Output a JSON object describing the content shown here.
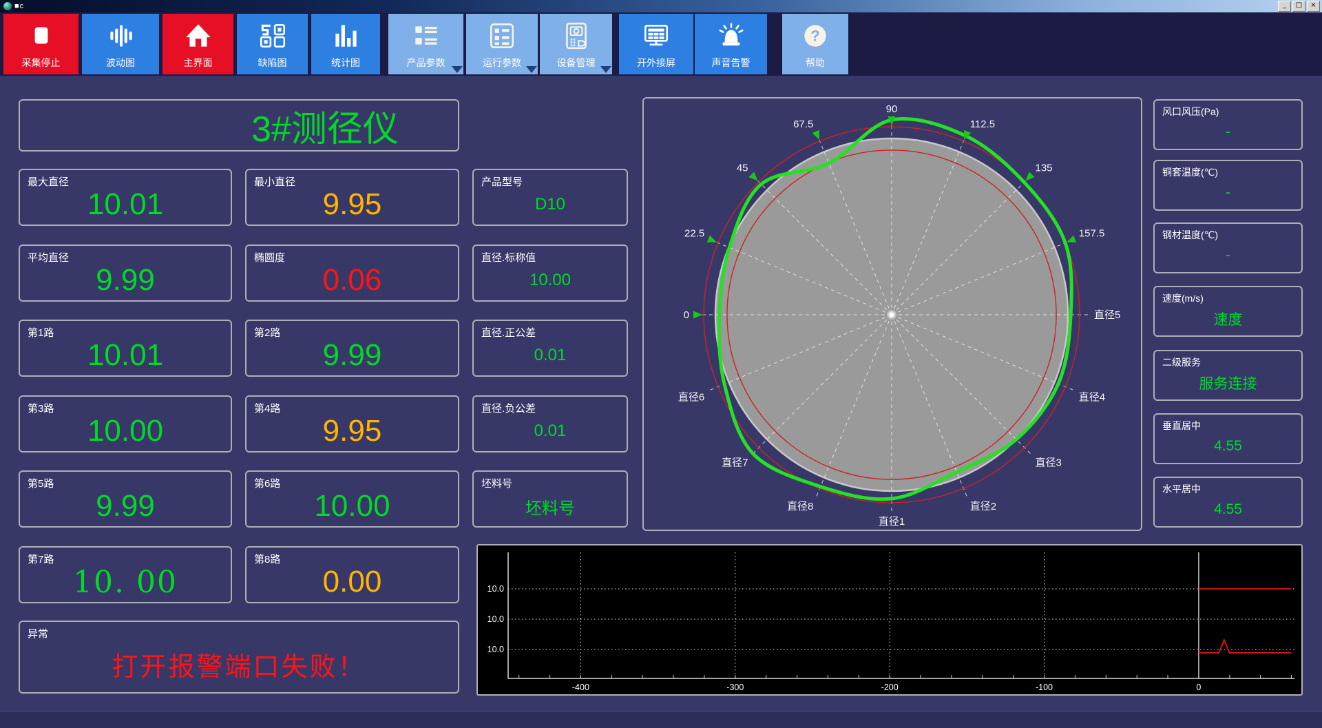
{
  "window": {
    "title": "■c",
    "controls": {
      "minimize": "_",
      "restore": "□",
      "close": "×"
    }
  },
  "toolbar": {
    "buttons": [
      {
        "name": "stop-capture",
        "label": "采集停止",
        "icon": "stop-icon",
        "style": "red",
        "dropdown": false
      },
      {
        "name": "wave-chart",
        "label": "波动图",
        "icon": "waveform-icon",
        "style": "blue",
        "dropdown": false
      },
      {
        "name": "main-screen",
        "label": "主界面",
        "icon": "home-icon",
        "style": "red",
        "dropdown": false
      },
      {
        "name": "defect-chart",
        "label": "缺陷图",
        "icon": "defect-grid-icon",
        "style": "blue",
        "dropdown": false
      },
      {
        "name": "stats-chart",
        "label": "统计图",
        "icon": "bar-chart-icon",
        "style": "blue",
        "dropdown": false
      },
      {
        "name": "product-params",
        "label": "产品参数",
        "icon": "list-icon",
        "style": "light",
        "dropdown": true
      },
      {
        "name": "run-params",
        "label": "运行参数",
        "icon": "form-icon",
        "style": "light",
        "dropdown": true
      },
      {
        "name": "device-manage",
        "label": "设备管理",
        "icon": "device-icon",
        "style": "light",
        "dropdown": true
      },
      {
        "name": "external-screen",
        "label": "开外接屏",
        "icon": "monitor-icon",
        "style": "blue",
        "dropdown": false
      },
      {
        "name": "sound-alarm",
        "label": "声音告警",
        "icon": "siren-icon",
        "style": "blue",
        "dropdown": false
      },
      {
        "name": "help",
        "label": "帮助",
        "icon": "help-icon",
        "style": "light",
        "dropdown": false
      }
    ]
  },
  "gauge_title": "3#测径仪",
  "metrics": {
    "col1": [
      {
        "name": "max-diameter",
        "label": "最大直径",
        "value": "10.01",
        "color": "green",
        "size": "big"
      },
      {
        "name": "avg-diameter",
        "label": "平均直径",
        "value": "9.99",
        "color": "green",
        "size": "big"
      },
      {
        "name": "path-1",
        "label": "第1路",
        "value": "10.01",
        "color": "green",
        "size": "big"
      },
      {
        "name": "path-3",
        "label": "第3路",
        "value": "10.00",
        "color": "green",
        "size": "big"
      },
      {
        "name": "path-5",
        "label": "第5路",
        "value": "9.99",
        "color": "green",
        "size": "big"
      },
      {
        "name": "path-7",
        "label": "第7路",
        "value": "10. 00",
        "color": "green",
        "size": "big",
        "serif": true
      }
    ],
    "col2": [
      {
        "name": "min-diameter",
        "label": "最小直径",
        "value": "9.95",
        "color": "orange",
        "size": "big"
      },
      {
        "name": "ovality",
        "label": "椭圆度",
        "value": "0.06",
        "color": "red",
        "size": "big"
      },
      {
        "name": "path-2",
        "label": "第2路",
        "value": "9.99",
        "color": "green",
        "size": "big"
      },
      {
        "name": "path-4",
        "label": "第4路",
        "value": "9.95",
        "color": "orange",
        "size": "big"
      },
      {
        "name": "path-6",
        "label": "第6路",
        "value": "10.00",
        "color": "green",
        "size": "big"
      },
      {
        "name": "path-8",
        "label": "第8路",
        "value": "0.00",
        "color": "orange",
        "size": "big"
      }
    ],
    "col3": [
      {
        "name": "product-model",
        "label": "产品型号",
        "value": "D10",
        "color": "green",
        "size": "small"
      },
      {
        "name": "nominal-diameter",
        "label": "直径.标称值",
        "value": "10.00",
        "color": "green",
        "size": "small"
      },
      {
        "name": "plus-tolerance",
        "label": "直径.正公差",
        "value": "0.01",
        "color": "green",
        "size": "small"
      },
      {
        "name": "minus-tolerance",
        "label": "直径.负公差",
        "value": "0.01",
        "color": "green",
        "size": "small"
      },
      {
        "name": "billet-no",
        "label": "坯料号",
        "value": "坯料号",
        "color": "green",
        "size": "small"
      }
    ]
  },
  "alarm": {
    "label": "异常",
    "value": "打开报警端口失败！"
  },
  "right_panel": [
    {
      "name": "air-pressure",
      "label": "风口风压(Pa)",
      "value": "-"
    },
    {
      "name": "copper-sleeve-temp",
      "label": "铜套温度(℃)",
      "value": "-"
    },
    {
      "name": "steel-temp",
      "label": "钢材温度(℃)",
      "value": "-"
    },
    {
      "name": "speed",
      "label": "速度(m/s)",
      "value": "速度"
    },
    {
      "name": "l2-service",
      "label": "二级服务",
      "value": "服务连接"
    },
    {
      "name": "vertical-center",
      "label": "垂直居中",
      "value": "4.55"
    },
    {
      "name": "horizontal-center",
      "label": "水平居中",
      "value": "4.55"
    }
  ],
  "colors": {
    "green": "#00d926",
    "orange": "#ffb400",
    "red": "#ff1414",
    "label": "#ffffff"
  },
  "chart_data": [
    {
      "type": "polar_profile",
      "title": "cross-section diameter profile (green = measured, red rings = tolerance, gray disc = nominal)",
      "nominal_radius_rel": 1.0,
      "tolerance_rings_rel": [
        0.934,
        1.066
      ],
      "spoke_step_deg": 22.5,
      "labels": [
        {
          "text": "0",
          "deg": 180,
          "marker": true
        },
        {
          "text": "22.5",
          "deg": 157.5,
          "marker": true
        },
        {
          "text": "45",
          "deg": 135,
          "marker": true
        },
        {
          "text": "67.5",
          "deg": 112.5,
          "marker": true
        },
        {
          "text": "90",
          "deg": 90,
          "marker": true
        },
        {
          "text": "112.5",
          "deg": 67.5,
          "marker": true
        },
        {
          "text": "135",
          "deg": 45,
          "marker": true
        },
        {
          "text": "157.5",
          "deg": 22.5,
          "marker": true
        },
        {
          "text": "直径5",
          "deg": 0,
          "marker": false
        },
        {
          "text": "直径4",
          "deg": -22.5,
          "marker": false
        },
        {
          "text": "直径3",
          "deg": -45,
          "marker": false
        },
        {
          "text": "直径2",
          "deg": -67.5,
          "marker": false
        },
        {
          "text": "直径1",
          "deg": -90,
          "marker": false
        },
        {
          "text": "直径8",
          "deg": -112.5,
          "marker": false
        },
        {
          "text": "直径7",
          "deg": -135,
          "marker": false
        },
        {
          "text": "直径6",
          "deg": -157.5,
          "marker": false
        }
      ],
      "profile": {
        "angles_deg": [
          180,
          157.5,
          135,
          112.5,
          90,
          67.5,
          45,
          22.5,
          0,
          -22.5,
          -45,
          -67.5,
          -90,
          -112.5,
          -135,
          -157.5
        ],
        "r_rel": [
          0.977,
          0.996,
          1.047,
          0.93,
          1.105,
          1.098,
          1.063,
          1.066,
          1.016,
          1.023,
          1.0,
          0.965,
          1.043,
          1.055,
          1.113,
          1.027
        ]
      },
      "colors": {
        "profile": "#26e026",
        "rings": "#cc2222",
        "disc": "#9a9a9a",
        "disc_edge": "#c8c8c8",
        "spokes": "#eeeeee",
        "marker": "#19c819",
        "text": "#f2f2f2"
      }
    },
    {
      "type": "line",
      "title": "diameter trend along length",
      "x_ticks": [
        -400,
        -300,
        -200,
        -100,
        0
      ],
      "x_range": [
        -447,
        62
      ],
      "x_minor_tick_step": 20,
      "y_gridline_labels": [
        "10.0",
        "10.0",
        "10.0"
      ],
      "zero_line_x": 0,
      "series": [
        {
          "name": "upper-line",
          "color": "#e81414",
          "x": [
            0,
            60
          ],
          "y_grid_units": [
            3,
            3
          ]
        },
        {
          "name": "lower-line",
          "color": "#e81414",
          "x": [
            0,
            13,
            16.5,
            20,
            60
          ],
          "y_grid_units": [
            0.89,
            0.89,
            1.31,
            0.89,
            0.89
          ]
        }
      ],
      "background": "#000000",
      "grid_color": "#ffffff",
      "axis_color": "#d8d8d8"
    }
  ]
}
